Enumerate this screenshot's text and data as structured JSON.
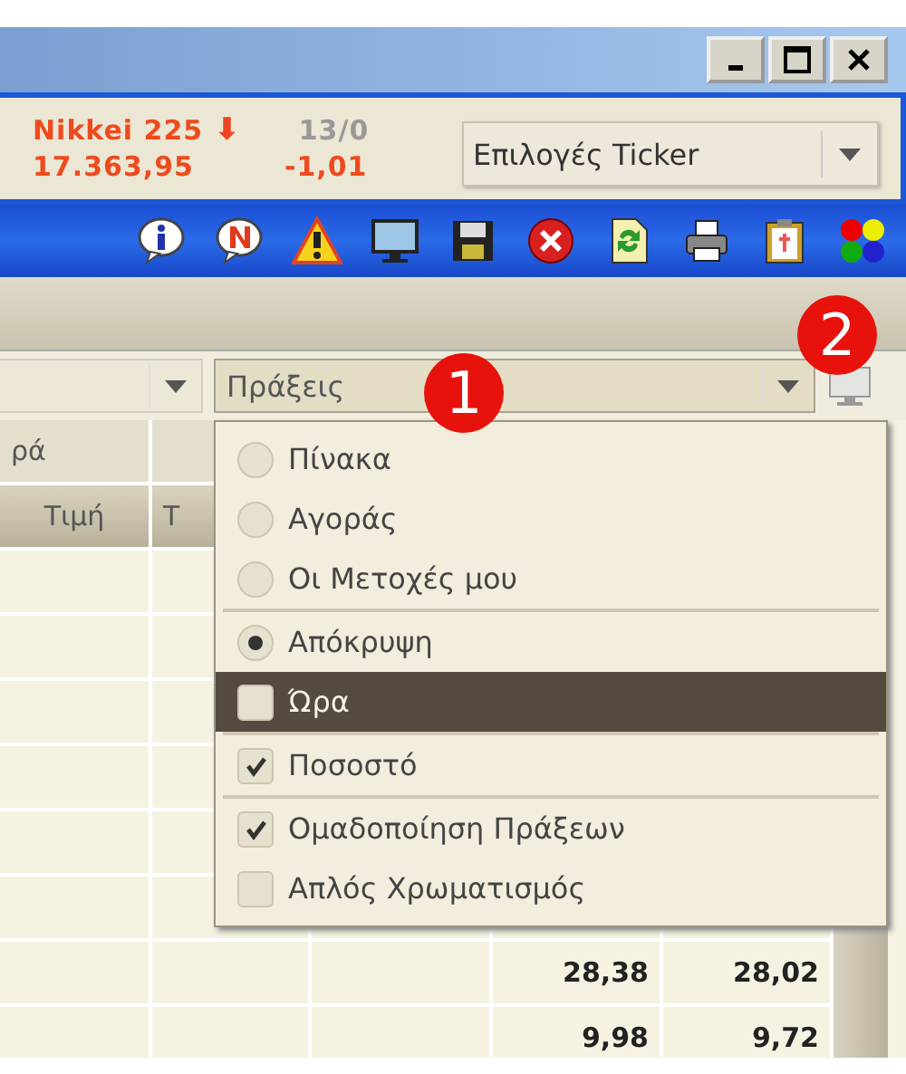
{
  "ticker": {
    "items": [
      {
        "name": "Nikkei 225",
        "arrow": "⬇",
        "date": "13/0",
        "value": "17.363,95",
        "change": "-1,01"
      }
    ]
  },
  "ticker_options": {
    "label": "Επιλογές Ticker"
  },
  "combos": [
    {
      "open": false
    },
    {
      "value": "Πράξεις",
      "open": true
    }
  ],
  "badges": [
    "1",
    "2"
  ],
  "table": {
    "header_rows": [
      [
        "ρά",
        ""
      ],
      [
        "Τιμή",
        "Τ"
      ]
    ],
    "rows": [
      {
        "column_4": "28,38",
        "column_5": "28,02"
      },
      {
        "column_4": "9,98",
        "column_5": "9,72"
      }
    ]
  },
  "menu": {
    "groups": [
      [
        {
          "kind": "radio",
          "label": "Πίνακα",
          "checked": false,
          "highlighted": false
        },
        {
          "kind": "radio",
          "label": "Αγοράς",
          "checked": false,
          "highlighted": false
        },
        {
          "kind": "radio",
          "label": "Οι Μετοχές μου",
          "checked": false,
          "highlighted": false
        }
      ],
      [
        {
          "kind": "radio",
          "label": "Απόκρυψη",
          "checked": true,
          "highlighted": false
        },
        {
          "kind": "check",
          "label": "Ώρα",
          "checked": false,
          "highlighted": true
        }
      ],
      [
        {
          "kind": "check",
          "label": "Ποσοστό",
          "checked": true,
          "highlighted": false
        }
      ],
      [
        {
          "kind": "check",
          "label": "Ομαδοποίηση Πράξεων",
          "checked": true,
          "highlighted": false
        },
        {
          "kind": "check",
          "label": "Απλός Χρωματισμός",
          "checked": false,
          "highlighted": false
        }
      ]
    ]
  }
}
